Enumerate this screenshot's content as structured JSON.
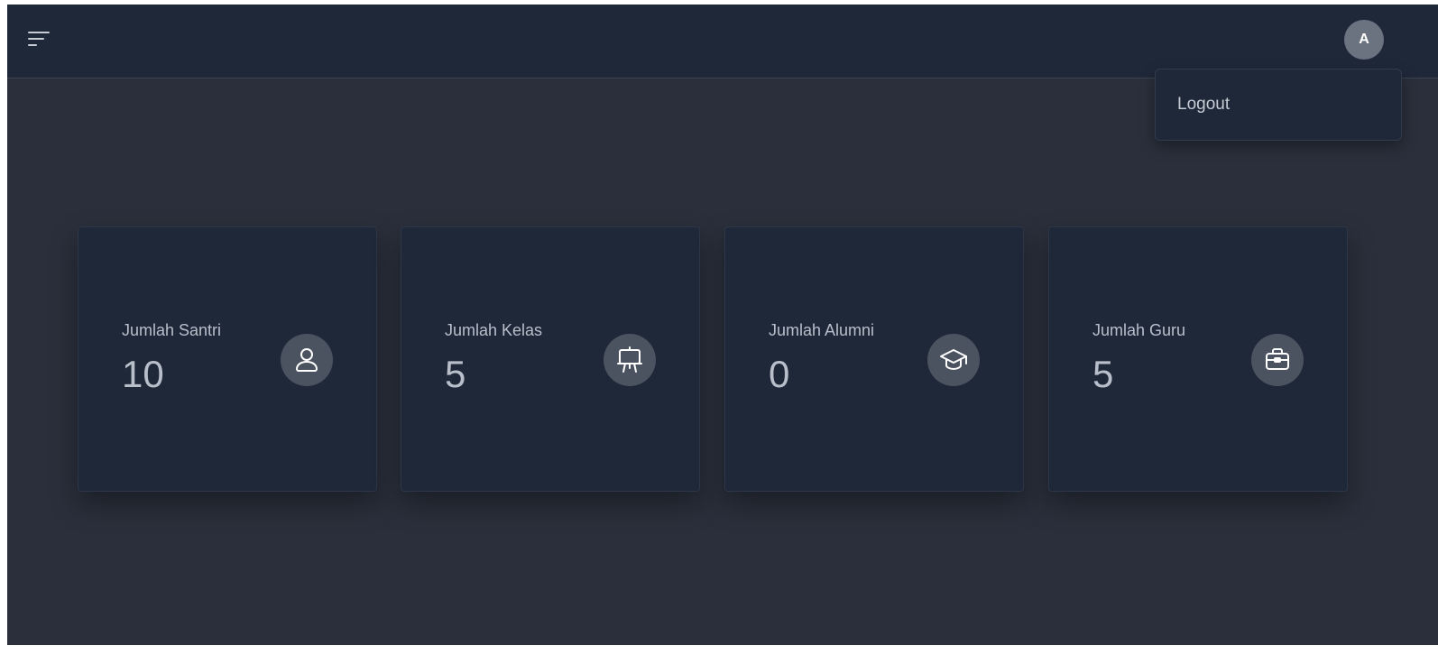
{
  "header": {
    "menu_icon": "hamburger-menu-icon",
    "avatar_initial": "A"
  },
  "user_menu": {
    "items": [
      {
        "label": "Logout"
      }
    ]
  },
  "stats": [
    {
      "label": "Jumlah Santri",
      "value": "10",
      "icon": "user-icon"
    },
    {
      "label": "Jumlah Kelas",
      "value": "5",
      "icon": "presentation-board-icon"
    },
    {
      "label": "Jumlah Alumni",
      "value": "0",
      "icon": "graduation-cap-icon"
    },
    {
      "label": "Jumlah Guru",
      "value": "5",
      "icon": "briefcase-icon"
    }
  ],
  "colors": {
    "background": "#2a2f3b",
    "surface": "#1f2839",
    "icon_circle": "#4b5260",
    "avatar": "#6b7280",
    "text": "#b9bfca"
  }
}
